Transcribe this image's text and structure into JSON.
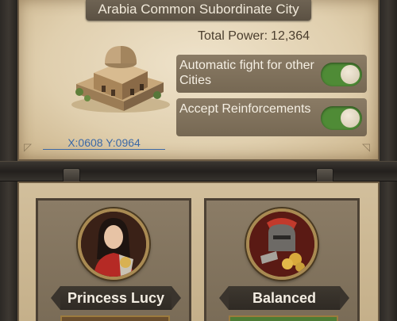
{
  "city": {
    "title": "Arabia Common Subordinate City",
    "power_label": "Total Power:",
    "power_value": "12,364",
    "coords": "X:0608 Y:0964",
    "image_icon": "city-building-icon"
  },
  "settings": [
    {
      "label": "Automatic fight for other Cities",
      "enabled": true
    },
    {
      "label": "Accept Reinforcements",
      "enabled": true
    }
  ],
  "options": [
    {
      "name": "Princess Lucy",
      "icon": "hero-portrait-icon"
    },
    {
      "name": "Balanced",
      "icon": "helmet-gold-icon"
    }
  ],
  "colors": {
    "toggle_on": "#4f8b36",
    "coords_link": "#3c69a6",
    "parchment": "#e0cfae"
  }
}
